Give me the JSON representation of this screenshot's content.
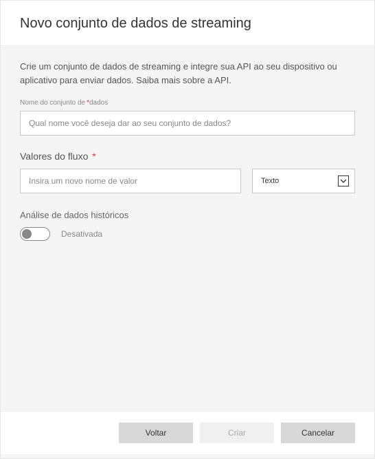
{
  "header": {
    "title": "Novo conjunto de dados de streaming"
  },
  "intro": {
    "text": "Crie um conjunto de dados de streaming e integre sua API ao seu dispositivo ou aplicativo para enviar dados. Saiba mais sobre a API."
  },
  "datasetName": {
    "label_pre": "Nome do conjunto de",
    "label_post": "dados",
    "required_star": "*",
    "placeholder": "Qual nome você deseja dar ao seu conjunto de dados?"
  },
  "streamValues": {
    "label": "Valores do fluxo",
    "required_star": "*",
    "value_placeholder": "Insira um novo nome de valor",
    "type_selected": "Texto"
  },
  "historic": {
    "label": "Análise de dados históricos",
    "status": "Desativada"
  },
  "footer": {
    "back": "Voltar",
    "create": "Criar",
    "cancel": "Cancelar"
  }
}
